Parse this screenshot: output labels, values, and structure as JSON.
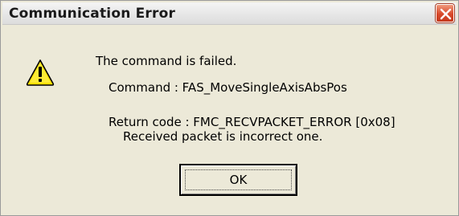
{
  "window": {
    "title": "Communication Error",
    "close_icon": "close-icon"
  },
  "message": {
    "icon": "warning-icon",
    "line1": "The command is failed.",
    "command_line": "Command : FAS_MoveSingleAxisAbsPos",
    "return_code_line": "Return code : FMC_RECVPACKET_ERROR [0x08]",
    "detail_line": "Received packet is incorrect one."
  },
  "buttons": {
    "ok_label": "OK"
  },
  "colors": {
    "close_button": "#d8482a",
    "warning_yellow": "#ffe000",
    "dialog_bg": "#ece9d8"
  }
}
